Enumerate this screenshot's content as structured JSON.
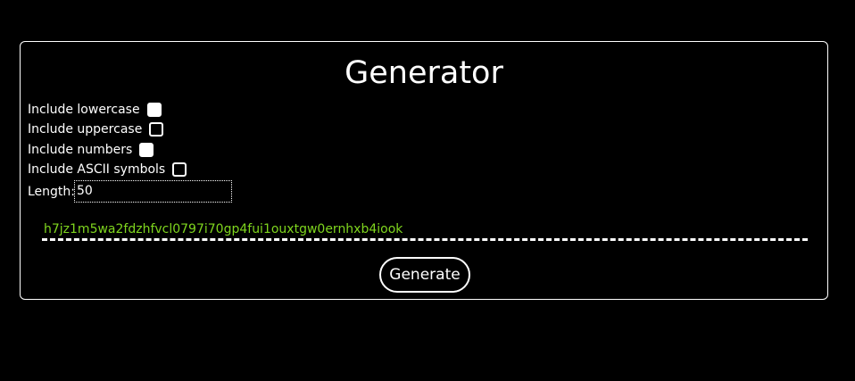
{
  "app": {
    "title": "Generator"
  },
  "options": [
    {
      "label": "Include lowercase",
      "checked": true
    },
    {
      "label": "Include uppercase",
      "checked": false
    },
    {
      "label": "Include numbers",
      "checked": true
    },
    {
      "label": "Include ASCII symbols",
      "checked": false
    }
  ],
  "length": {
    "label": "Length:",
    "value": "50"
  },
  "output": {
    "text": "h7jz1m5wa2fdzhfvcl0797i70gp4fui1ouxtgw0ernhxb4iook"
  },
  "actions": {
    "generate_label": "Generate"
  },
  "colors": {
    "background": "#000000",
    "foreground": "#ffffff",
    "output_text": "#7fd61e"
  }
}
